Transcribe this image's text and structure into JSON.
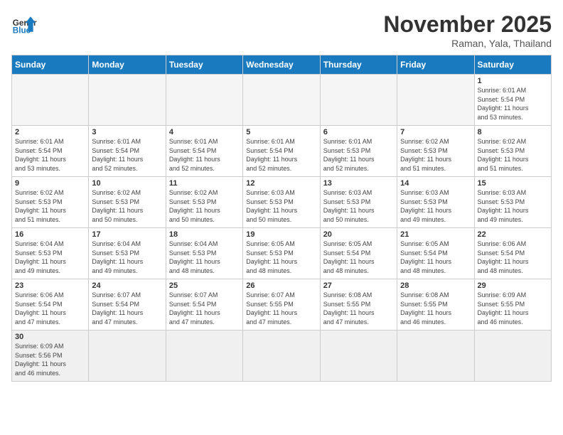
{
  "header": {
    "logo_general": "General",
    "logo_blue": "Blue",
    "month": "November 2025",
    "location": "Raman, Yala, Thailand"
  },
  "weekdays": [
    "Sunday",
    "Monday",
    "Tuesday",
    "Wednesday",
    "Thursday",
    "Friday",
    "Saturday"
  ],
  "weeks": [
    [
      {
        "day": "",
        "info": ""
      },
      {
        "day": "",
        "info": ""
      },
      {
        "day": "",
        "info": ""
      },
      {
        "day": "",
        "info": ""
      },
      {
        "day": "",
        "info": ""
      },
      {
        "day": "",
        "info": ""
      },
      {
        "day": "1",
        "info": "Sunrise: 6:01 AM\nSunset: 5:54 PM\nDaylight: 11 hours\nand 53 minutes."
      }
    ],
    [
      {
        "day": "2",
        "info": "Sunrise: 6:01 AM\nSunset: 5:54 PM\nDaylight: 11 hours\nand 53 minutes."
      },
      {
        "day": "3",
        "info": "Sunrise: 6:01 AM\nSunset: 5:54 PM\nDaylight: 11 hours\nand 52 minutes."
      },
      {
        "day": "4",
        "info": "Sunrise: 6:01 AM\nSunset: 5:54 PM\nDaylight: 11 hours\nand 52 minutes."
      },
      {
        "day": "5",
        "info": "Sunrise: 6:01 AM\nSunset: 5:54 PM\nDaylight: 11 hours\nand 52 minutes."
      },
      {
        "day": "6",
        "info": "Sunrise: 6:01 AM\nSunset: 5:53 PM\nDaylight: 11 hours\nand 52 minutes."
      },
      {
        "day": "7",
        "info": "Sunrise: 6:02 AM\nSunset: 5:53 PM\nDaylight: 11 hours\nand 51 minutes."
      },
      {
        "day": "8",
        "info": "Sunrise: 6:02 AM\nSunset: 5:53 PM\nDaylight: 11 hours\nand 51 minutes."
      }
    ],
    [
      {
        "day": "9",
        "info": "Sunrise: 6:02 AM\nSunset: 5:53 PM\nDaylight: 11 hours\nand 51 minutes."
      },
      {
        "day": "10",
        "info": "Sunrise: 6:02 AM\nSunset: 5:53 PM\nDaylight: 11 hours\nand 50 minutes."
      },
      {
        "day": "11",
        "info": "Sunrise: 6:02 AM\nSunset: 5:53 PM\nDaylight: 11 hours\nand 50 minutes."
      },
      {
        "day": "12",
        "info": "Sunrise: 6:03 AM\nSunset: 5:53 PM\nDaylight: 11 hours\nand 50 minutes."
      },
      {
        "day": "13",
        "info": "Sunrise: 6:03 AM\nSunset: 5:53 PM\nDaylight: 11 hours\nand 50 minutes."
      },
      {
        "day": "14",
        "info": "Sunrise: 6:03 AM\nSunset: 5:53 PM\nDaylight: 11 hours\nand 49 minutes."
      },
      {
        "day": "15",
        "info": "Sunrise: 6:03 AM\nSunset: 5:53 PM\nDaylight: 11 hours\nand 49 minutes."
      }
    ],
    [
      {
        "day": "16",
        "info": "Sunrise: 6:04 AM\nSunset: 5:53 PM\nDaylight: 11 hours\nand 49 minutes."
      },
      {
        "day": "17",
        "info": "Sunrise: 6:04 AM\nSunset: 5:53 PM\nDaylight: 11 hours\nand 49 minutes."
      },
      {
        "day": "18",
        "info": "Sunrise: 6:04 AM\nSunset: 5:53 PM\nDaylight: 11 hours\nand 48 minutes."
      },
      {
        "day": "19",
        "info": "Sunrise: 6:05 AM\nSunset: 5:53 PM\nDaylight: 11 hours\nand 48 minutes."
      },
      {
        "day": "20",
        "info": "Sunrise: 6:05 AM\nSunset: 5:54 PM\nDaylight: 11 hours\nand 48 minutes."
      },
      {
        "day": "21",
        "info": "Sunrise: 6:05 AM\nSunset: 5:54 PM\nDaylight: 11 hours\nand 48 minutes."
      },
      {
        "day": "22",
        "info": "Sunrise: 6:06 AM\nSunset: 5:54 PM\nDaylight: 11 hours\nand 48 minutes."
      }
    ],
    [
      {
        "day": "23",
        "info": "Sunrise: 6:06 AM\nSunset: 5:54 PM\nDaylight: 11 hours\nand 47 minutes."
      },
      {
        "day": "24",
        "info": "Sunrise: 6:07 AM\nSunset: 5:54 PM\nDaylight: 11 hours\nand 47 minutes."
      },
      {
        "day": "25",
        "info": "Sunrise: 6:07 AM\nSunset: 5:54 PM\nDaylight: 11 hours\nand 47 minutes."
      },
      {
        "day": "26",
        "info": "Sunrise: 6:07 AM\nSunset: 5:55 PM\nDaylight: 11 hours\nand 47 minutes."
      },
      {
        "day": "27",
        "info": "Sunrise: 6:08 AM\nSunset: 5:55 PM\nDaylight: 11 hours\nand 47 minutes."
      },
      {
        "day": "28",
        "info": "Sunrise: 6:08 AM\nSunset: 5:55 PM\nDaylight: 11 hours\nand 46 minutes."
      },
      {
        "day": "29",
        "info": "Sunrise: 6:09 AM\nSunset: 5:55 PM\nDaylight: 11 hours\nand 46 minutes."
      }
    ],
    [
      {
        "day": "30",
        "info": "Sunrise: 6:09 AM\nSunset: 5:56 PM\nDaylight: 11 hours\nand 46 minutes."
      },
      {
        "day": "",
        "info": ""
      },
      {
        "day": "",
        "info": ""
      },
      {
        "day": "",
        "info": ""
      },
      {
        "day": "",
        "info": ""
      },
      {
        "day": "",
        "info": ""
      },
      {
        "day": "",
        "info": ""
      }
    ]
  ]
}
